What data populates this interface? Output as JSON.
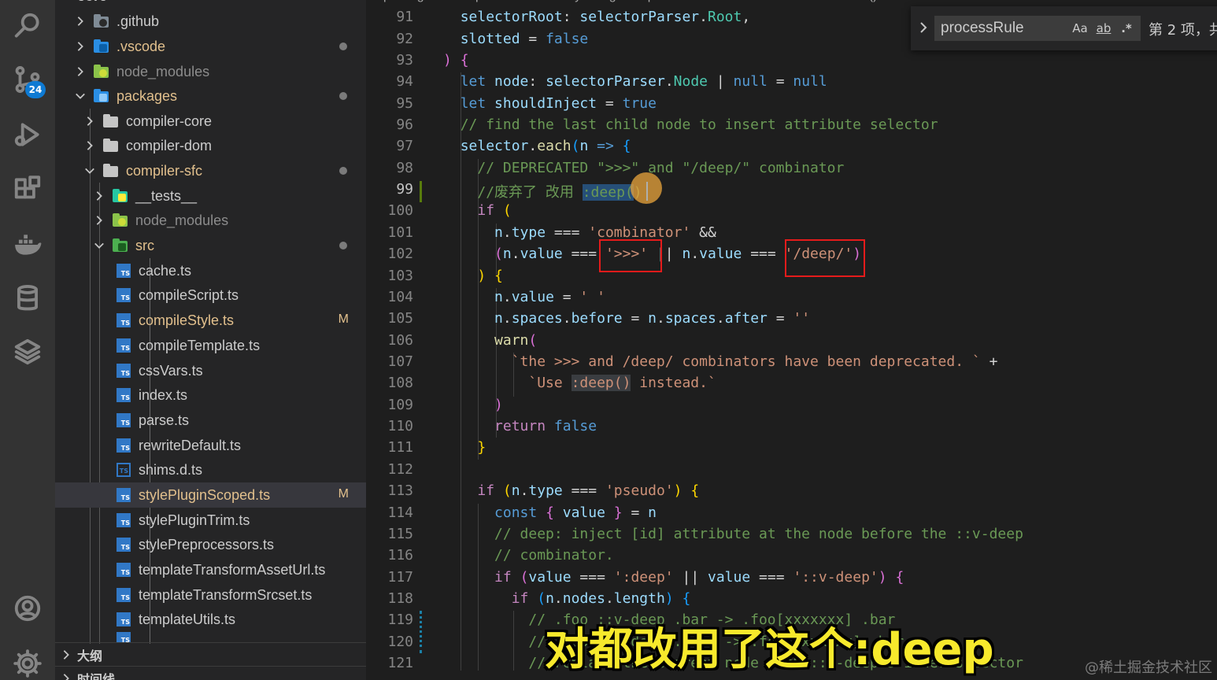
{
  "activity_bar": {
    "icons": [
      "search-icon",
      "source-control-icon",
      "run-debug-icon",
      "extensions-icon",
      "docker-icon",
      "database-icon",
      "layers-icon",
      "account-icon",
      "settings-gear-icon"
    ],
    "source_control_badge": "24"
  },
  "explorer": {
    "top_cut": "core",
    "items": [
      {
        "label": ".github",
        "kind": "folder",
        "color": "#7f8b96"
      },
      {
        "label": ".vscode",
        "kind": "folder",
        "color": "#2a8ee4"
      },
      {
        "label": "node_modules",
        "kind": "folder",
        "color": "#8bc34a"
      },
      {
        "label": "packages",
        "kind": "folder",
        "color": "#2a8ee4"
      },
      {
        "label": "compiler-core",
        "kind": "folder",
        "color": "#c5c5c5"
      },
      {
        "label": "compiler-dom",
        "kind": "folder",
        "color": "#c5c5c5"
      },
      {
        "label": "compiler-sfc",
        "kind": "folder",
        "color": "#c5c5c5"
      },
      {
        "label": "__tests__",
        "kind": "folder",
        "color": "#26c6a2"
      },
      {
        "label": "node_modules",
        "kind": "folder",
        "color": "#8bc34a"
      },
      {
        "label": "src",
        "kind": "folder",
        "color": "#4caf50"
      },
      {
        "label": "cache.ts",
        "kind": "ts"
      },
      {
        "label": "compileScript.ts",
        "kind": "ts"
      },
      {
        "label": "compileStyle.ts",
        "kind": "ts",
        "status": "M"
      },
      {
        "label": "compileTemplate.ts",
        "kind": "ts"
      },
      {
        "label": "cssVars.ts",
        "kind": "ts"
      },
      {
        "label": "index.ts",
        "kind": "ts"
      },
      {
        "label": "parse.ts",
        "kind": "ts"
      },
      {
        "label": "rewriteDefault.ts",
        "kind": "ts"
      },
      {
        "label": "shims.d.ts",
        "kind": "ts"
      },
      {
        "label": "stylePluginScoped.ts",
        "kind": "ts",
        "status": "M"
      },
      {
        "label": "stylePluginTrim.ts",
        "kind": "ts"
      },
      {
        "label": "stylePreprocessors.ts",
        "kind": "ts"
      },
      {
        "label": "templateTransformAssetUrl.ts",
        "kind": "ts"
      },
      {
        "label": "templateTransformSrcset.ts",
        "kind": "ts"
      },
      {
        "label": "templateUtils.ts",
        "kind": "ts"
      }
    ],
    "outline_label": "大纲",
    "timeline_label": "时间线"
  },
  "editor": {
    "breadcrumb": "packages > compiler-sfc > src > stylePluginScoped.ts > rewriteSelector > selector.each() callback",
    "active_line": "99",
    "line_numbers": [
      "91",
      "92",
      "93",
      "94",
      "95",
      "96",
      "97",
      "98",
      "99",
      "100",
      "101",
      "102",
      "103",
      "104",
      "105",
      "106",
      "107",
      "108",
      "109",
      "110",
      "111",
      "112",
      "113",
      "114",
      "115",
      "116",
      "117",
      "118",
      "119",
      "120",
      "121"
    ],
    "line_96_comment": "// find the last child node to insert attribute selector",
    "line_98_comment": "// DEPRECATED \">>>\" and \"/deep/\" combinator",
    "line_99_comment": "//废弃了 改用 ",
    "line_99_selection": ":deep(",
    "line_99_rest": ")",
    "line_107_string": "`the >>> and /deep/ combinators have been deprecated. `",
    "line_108_string_a": "`Use ",
    "line_108_string_hl": ":deep()",
    "line_108_string_b": " instead.`",
    "line_115_comment": "// deep: inject [id] attribute at the node before the ::v-deep",
    "line_116_comment": "// combinator.",
    "line_119_comment": "// .foo ::v-deep .bar -> .foo[xxxxxxx] .bar",
    "line_120_comment": "// .foo ::v-deep(.bar) -> .foo[xxxxxxx] .bar",
    "line_121_comment": "// replace the current node with ::v-deep's inner selector"
  },
  "find_widget": {
    "value": "processRule",
    "match_case_label": "Aa",
    "whole_word_label": "ab",
    "regex_label": ".*",
    "result_text": "第 2 项，共"
  },
  "overlay": {
    "subtitle": "对都改用了这个:deep",
    "watermark": "@稀土掘金技术社区"
  }
}
